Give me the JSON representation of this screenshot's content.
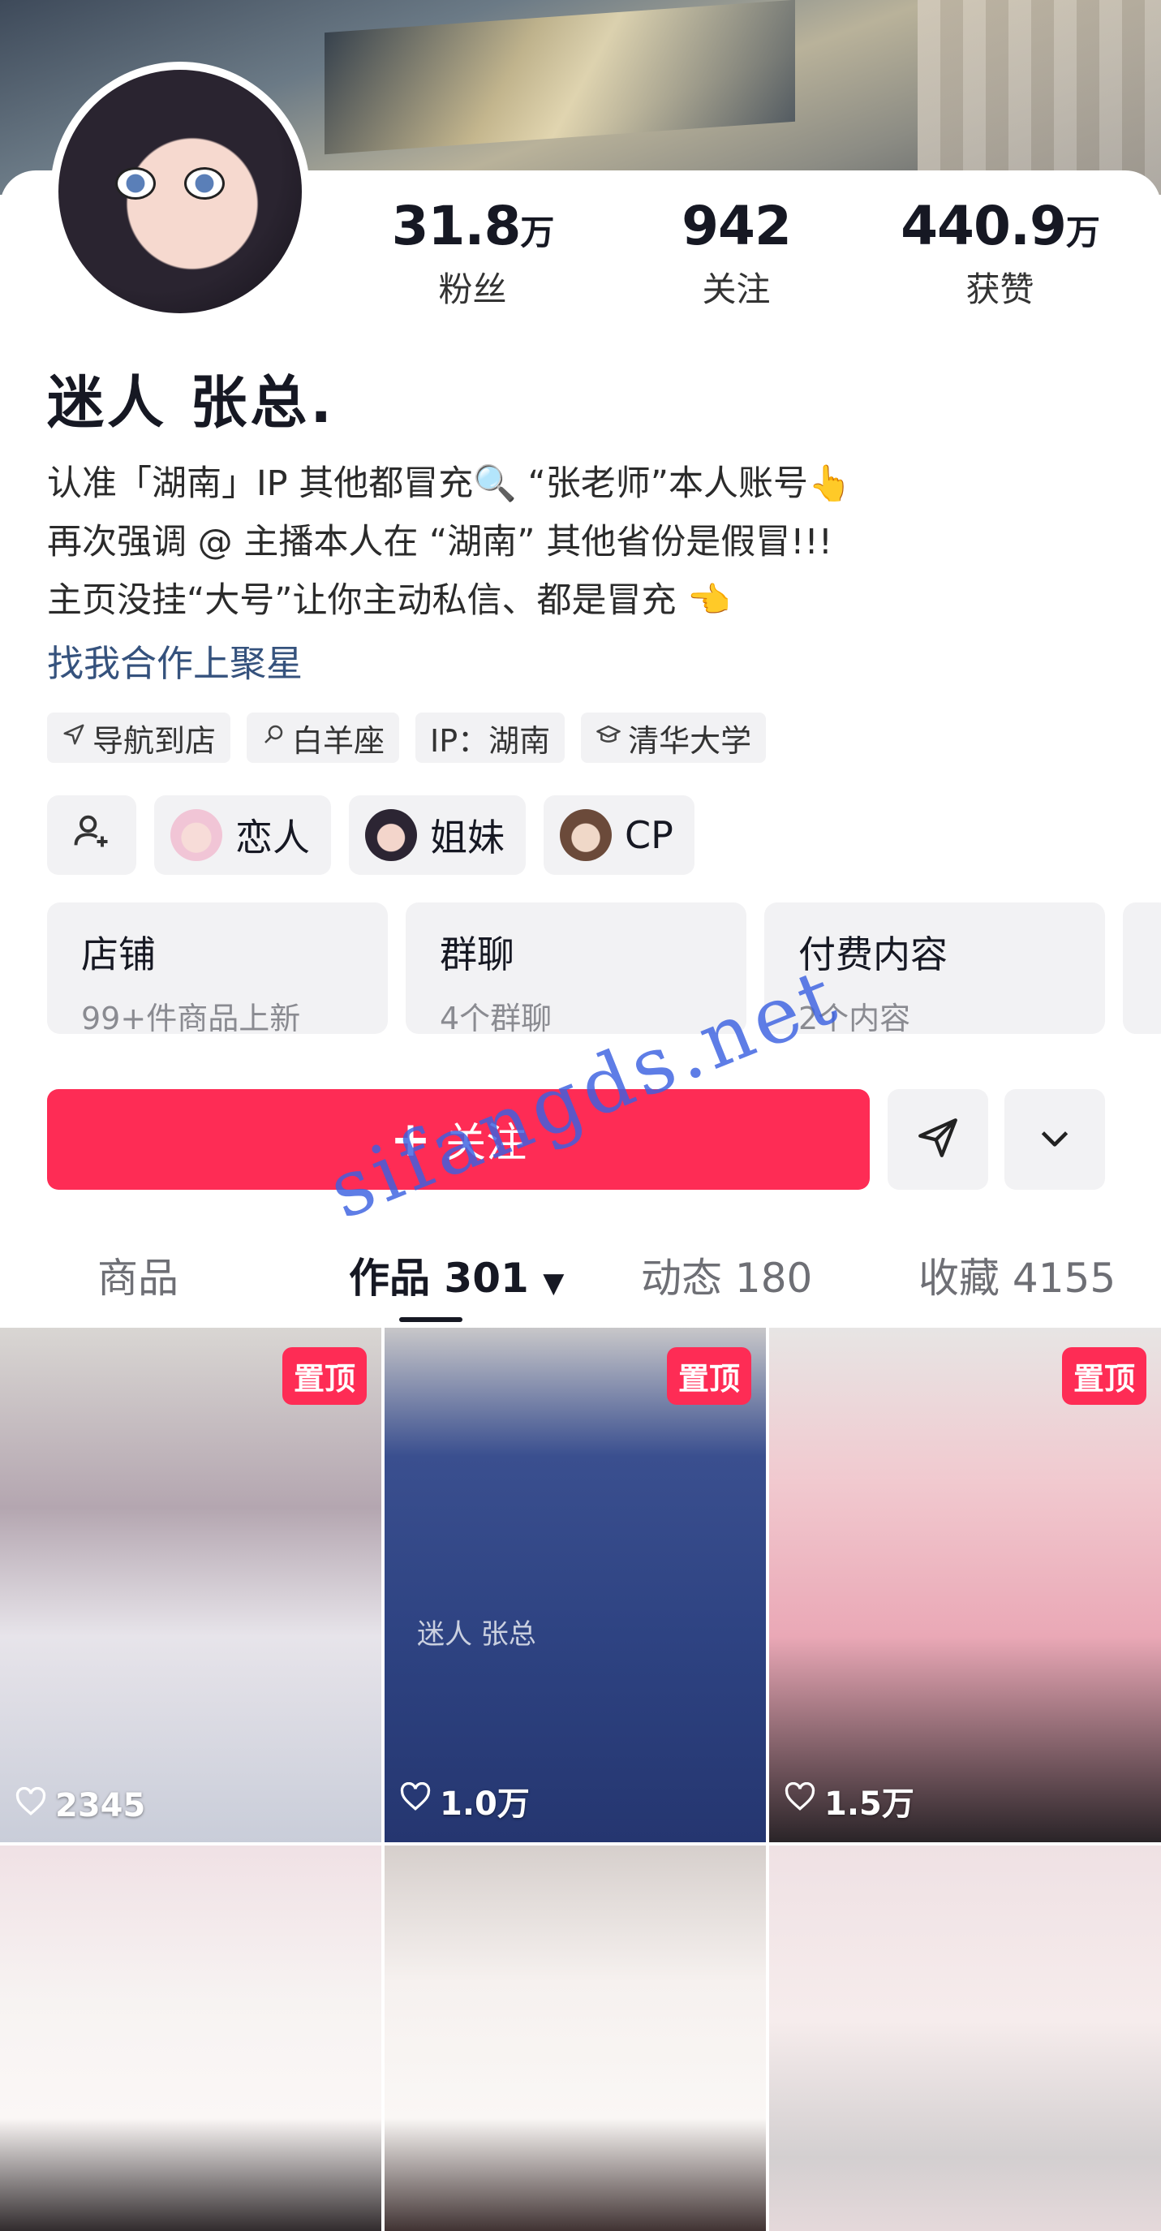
{
  "stats": [
    {
      "num": "31.8",
      "unit": "万",
      "label": "粉丝"
    },
    {
      "num": "942",
      "unit": "",
      "label": "关注"
    },
    {
      "num": "440.9",
      "unit": "万",
      "label": "获赞"
    }
  ],
  "profile": {
    "name": "迷人 张总.",
    "bio_lines": [
      "认准「湖南」IP 其他都冒充🔍 “张老师”本人账号👆",
      "再次强调 @ 主播本人在 “湖南” 其他省份是假冒!!!",
      "主页没挂“大号”让你主动私信、都是冒充 👈"
    ],
    "link": "找我合作上聚星"
  },
  "tags": [
    {
      "icon": "navigation-icon",
      "label": "导航到店"
    },
    {
      "icon": "zodiac-icon",
      "label": "白羊座"
    },
    {
      "icon": "",
      "label": "IP：湖南"
    },
    {
      "icon": "graduation-cap-icon",
      "label": "清华大学"
    }
  ],
  "relations": [
    {
      "label": "恋人"
    },
    {
      "label": "姐妹"
    },
    {
      "label": "CP"
    }
  ],
  "shop_cards": [
    {
      "title": "店铺",
      "sub": "99+件商品上新"
    },
    {
      "title": "群聊",
      "sub": "4个群聊"
    },
    {
      "title": "付费内容",
      "sub": "2个内容"
    }
  ],
  "actions": {
    "follow_label": "关注"
  },
  "tabs": [
    {
      "label": "商品"
    },
    {
      "label": "作品 301"
    },
    {
      "label": "动态 180"
    },
    {
      "label": "收藏 4155"
    }
  ],
  "videos": [
    {
      "pinned": "置顶",
      "likes": "2345"
    },
    {
      "pinned": "置顶",
      "likes": "1.0万",
      "overlay": "迷人 张总"
    },
    {
      "pinned": "置顶",
      "likes": "1.5万"
    }
  ],
  "watermark": "sifangds.net",
  "colors": {
    "accent": "#fe2c55",
    "link": "#35527d",
    "chip_bg": "#f2f2f4"
  }
}
